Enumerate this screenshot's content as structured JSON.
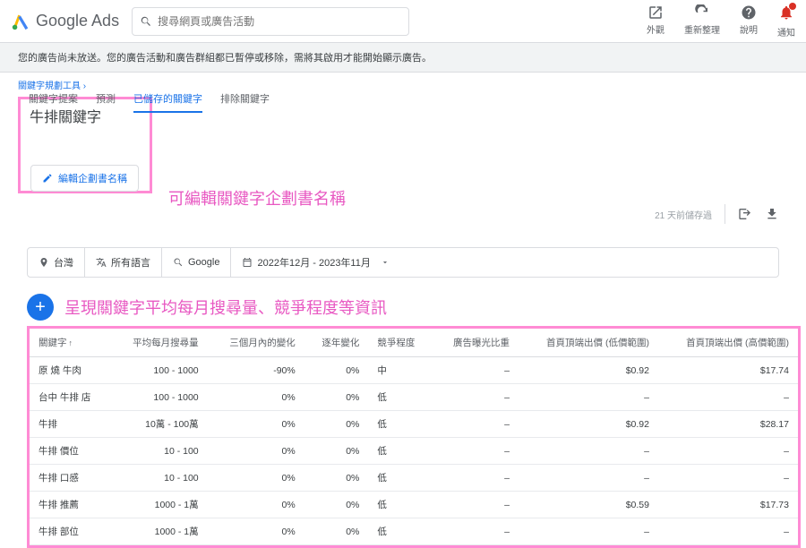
{
  "header": {
    "product": "Google Ads",
    "search_placeholder": "搜尋網頁或廣告活動",
    "actions": [
      {
        "icon": "external",
        "label": "外觀"
      },
      {
        "icon": "refresh",
        "label": "重新整理"
      },
      {
        "icon": "help",
        "label": "說明"
      },
      {
        "icon": "bell",
        "label": "通知"
      }
    ]
  },
  "alert": "您的廣告尚未放送。您的廣告活動和廣告群組都已暫停或移除，需將其啟用才能開始顯示廣告。",
  "breadcrumb": "關鍵字規劃工具 ›",
  "plan_title": "牛排關鍵字",
  "tabs": [
    {
      "label": "關鍵字提案",
      "active": false
    },
    {
      "label": "預測",
      "active": false
    },
    {
      "label": "已儲存的關鍵字",
      "active": true
    },
    {
      "label": "排除關鍵字",
      "active": false
    }
  ],
  "edit_plan_label": "編輯企劃書名稱",
  "saved_meta": "21 天前儲存過",
  "annotation_title": "可編輯關鍵字企劃書名稱",
  "filters": {
    "location": "台灣",
    "language": "所有語言",
    "network": "Google",
    "date_range": "2022年12月 - 2023年11月"
  },
  "annotation_table": "呈現關鍵字平均每月搜尋量、競爭程度等資訊",
  "columns": {
    "kw": "關鍵字",
    "avg": "平均每月搜尋量",
    "m3": "三個月內的變化",
    "yoy": "逐年變化",
    "comp": "競爭程度",
    "impr": "廣告曝光比重",
    "low": "首頁頂端出價 (低價範圍)",
    "high": "首頁頂端出價 (高價範圍)"
  },
  "rows": [
    {
      "kw": "原 燒 牛肉",
      "avg": "100 - 1000",
      "m3": "-90%",
      "yoy": "0%",
      "comp": "中",
      "impr": "–",
      "low": "$0.92",
      "high": "$17.74"
    },
    {
      "kw": "台中 牛排 店",
      "avg": "100 - 1000",
      "m3": "0%",
      "yoy": "0%",
      "comp": "低",
      "impr": "–",
      "low": "–",
      "high": "–"
    },
    {
      "kw": "牛排",
      "avg": "10萬 - 100萬",
      "m3": "0%",
      "yoy": "0%",
      "comp": "低",
      "impr": "–",
      "low": "$0.92",
      "high": "$28.17"
    },
    {
      "kw": "牛排 價位",
      "avg": "10 - 100",
      "m3": "0%",
      "yoy": "0%",
      "comp": "低",
      "impr": "–",
      "low": "–",
      "high": "–"
    },
    {
      "kw": "牛排 口感",
      "avg": "10 - 100",
      "m3": "0%",
      "yoy": "0%",
      "comp": "低",
      "impr": "–",
      "low": "–",
      "high": "–"
    },
    {
      "kw": "牛排 推薦",
      "avg": "1000 - 1萬",
      "m3": "0%",
      "yoy": "0%",
      "comp": "低",
      "impr": "–",
      "low": "$0.59",
      "high": "$17.73"
    },
    {
      "kw": "牛排 部位",
      "avg": "1000 - 1萬",
      "m3": "0%",
      "yoy": "0%",
      "comp": "低",
      "impr": "–",
      "low": "–",
      "high": "–"
    }
  ]
}
